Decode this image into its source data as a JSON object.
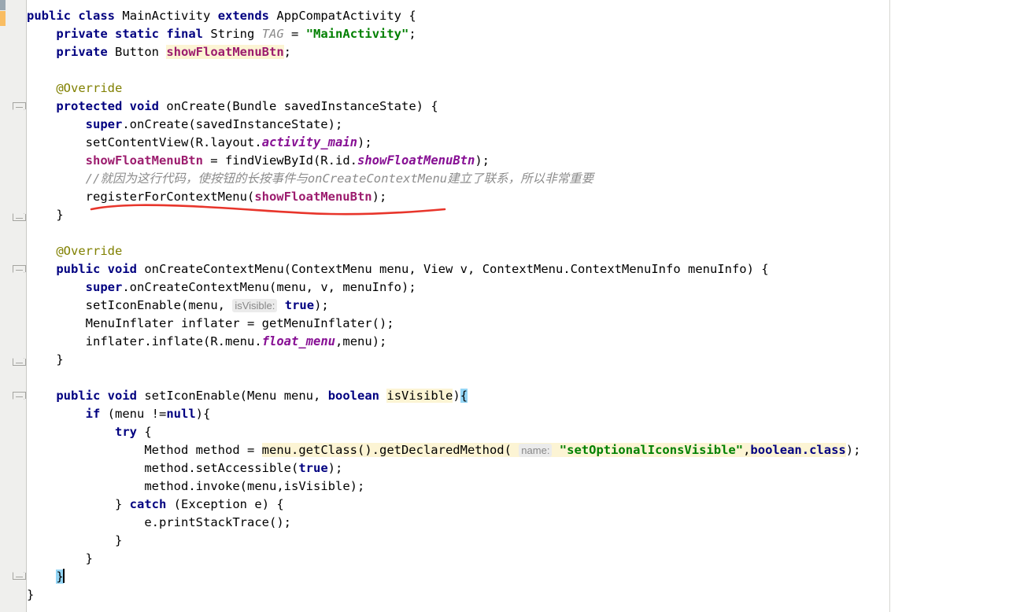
{
  "editor": {
    "language": "java",
    "class_name": "MainActivity",
    "colors": {
      "background": "#ffffff",
      "gutter": "#efefed",
      "keyword": "#000080",
      "string": "#008000",
      "field": "#871094",
      "field_bold": "#9c1c6e",
      "static_field": "#8c8c8c",
      "annotation": "#808000",
      "comment": "#8c8c8c",
      "identifier_highlight": "#fcf4d4",
      "brace_match_highlight": "#93d5f5",
      "current_line": "#fdf8e3",
      "inlay_hint_bg": "#ebebeb",
      "inlay_hint_fg": "#878787",
      "vcs_modified": "#9aa7b0",
      "vcs_added": "#f9bd62",
      "annotation_mark": "#e8352b",
      "right_margin_guide": "#d6d6d2"
    },
    "current_line_index": 31,
    "caret_line_text": "    }",
    "lines": [
      {
        "n": 1,
        "text": "public class MainActivity extends AppCompatActivity {"
      },
      {
        "n": 2,
        "text": "    private static final String TAG = \"MainActivity\";"
      },
      {
        "n": 3,
        "text": "    private Button showFloatMenuBtn;"
      },
      {
        "n": 4,
        "text": ""
      },
      {
        "n": 5,
        "text": "    @Override"
      },
      {
        "n": 6,
        "text": "    protected void onCreate(Bundle savedInstanceState) {"
      },
      {
        "n": 7,
        "text": "        super.onCreate(savedInstanceState);"
      },
      {
        "n": 8,
        "text": "        setContentView(R.layout.activity_main);"
      },
      {
        "n": 9,
        "text": "        showFloatMenuBtn = findViewById(R.id.showFloatMenuBtn);"
      },
      {
        "n": 10,
        "text": "        //就因为这行代码，使按钮的长按事件与onCreateContextMenu建立了联系，所以非常重要"
      },
      {
        "n": 11,
        "text": "        registerForContextMenu(showFloatMenuBtn);"
      },
      {
        "n": 12,
        "text": "    }"
      },
      {
        "n": 13,
        "text": ""
      },
      {
        "n": 14,
        "text": "    @Override"
      },
      {
        "n": 15,
        "text": "    public void onCreateContextMenu(ContextMenu menu, View v, ContextMenu.ContextMenuInfo menuInfo) {"
      },
      {
        "n": 16,
        "text": "        super.onCreateContextMenu(menu, v, menuInfo);"
      },
      {
        "n": 17,
        "text": "        setIconEnable(menu, true);"
      },
      {
        "n": 18,
        "text": "        MenuInflater inflater = getMenuInflater();"
      },
      {
        "n": 19,
        "text": "        inflater.inflate(R.menu.float_menu,menu);"
      },
      {
        "n": 20,
        "text": "    }"
      },
      {
        "n": 21,
        "text": ""
      },
      {
        "n": 22,
        "text": "    public void setIconEnable(Menu menu, boolean isVisible){"
      },
      {
        "n": 23,
        "text": "        if (menu !=null){"
      },
      {
        "n": 24,
        "text": "            try {"
      },
      {
        "n": 25,
        "text": "                Method method = menu.getClass().getDeclaredMethod(\"setOptionalIconsVisible\",boolean.class);"
      },
      {
        "n": 26,
        "text": "                method.setAccessible(true);"
      },
      {
        "n": 27,
        "text": "                method.invoke(menu,isVisible);"
      },
      {
        "n": 28,
        "text": "            } catch (Exception e) {"
      },
      {
        "n": 29,
        "text": "                e.printStackTrace();"
      },
      {
        "n": 30,
        "text": "            }"
      },
      {
        "n": 31,
        "text": "        }"
      },
      {
        "n": 32,
        "text": "    }"
      },
      {
        "n": 33,
        "text": "}"
      }
    ],
    "tokens": {
      "kw_public": "public",
      "kw_class": "class",
      "kw_extends": "extends",
      "kw_private": "private",
      "kw_static": "static",
      "kw_final": "final",
      "kw_protected": "protected",
      "kw_void": "void",
      "kw_super": "super",
      "kw_boolean": "boolean",
      "kw_if": "if",
      "kw_try": "try",
      "kw_catch": "catch",
      "kw_null": "null",
      "kw_true": "true",
      "type_String": "String",
      "type_Button": "Button",
      "type_Bundle": "Bundle",
      "type_Menu": "Menu",
      "type_MenuInflater": "MenuInflater",
      "type_Method": "Method",
      "type_View": "View",
      "type_ContextMenu": "ContextMenu",
      "type_Exception": "Exception",
      "name_class": "MainActivity",
      "name_super_class": "AppCompatActivity",
      "const_TAG": "TAG",
      "str_MainActivity": "\"MainActivity\"",
      "field_showFloatMenuBtn": "showFloatMenuBtn",
      "annotation_override": "@Override",
      "method_onCreate": "onCreate",
      "param_savedInstanceState": "savedInstanceState",
      "method_setContentView": "setContentView",
      "res_R": "R",
      "res_layout": "layout",
      "res_activity_main": "activity_main",
      "method_findViewById": "findViewById",
      "res_id": "id",
      "comment_chinese": "//就因为这行代码，使按钮的长按事件与onCreateContextMenu建立了联系，所以非常重要",
      "method_registerForContextMenu": "registerForContextMenu",
      "method_onCreateContextMenu": "onCreateContextMenu",
      "param_menu": "menu",
      "param_v": "v",
      "param_menuInfo": "menuInfo",
      "method_setIconEnable": "setIconEnable",
      "var_inflater": "inflater",
      "method_getMenuInflater": "getMenuInflater",
      "method_inflate": "inflate",
      "res_menu": "menu",
      "res_float_menu": "float_menu",
      "param_isVisible": "isVisible",
      "var_method": "method",
      "method_getClass": "getClass",
      "method_getDeclaredMethod": "getDeclaredMethod",
      "str_setOptionalIconsVisible": "\"setOptionalIconsVisible\"",
      "boolean_class": "boolean.class",
      "method_setAccessible": "setAccessible",
      "method_invoke": "invoke",
      "var_e": "e",
      "method_printStackTrace": "printStackTrace"
    },
    "inlay_hints": [
      {
        "id": "hint-isVisible",
        "label": "isVisible:",
        "line": 17
      },
      {
        "id": "hint-name",
        "label": "name:",
        "line": 25
      }
    ],
    "annotations": [
      {
        "id": "red-underline",
        "type": "freehand-underline",
        "color": "#e8352b",
        "target_line": 11,
        "description": "hand-drawn red wavy underline beneath registerForContextMenu(showFloatMenuBtn);"
      }
    ]
  }
}
